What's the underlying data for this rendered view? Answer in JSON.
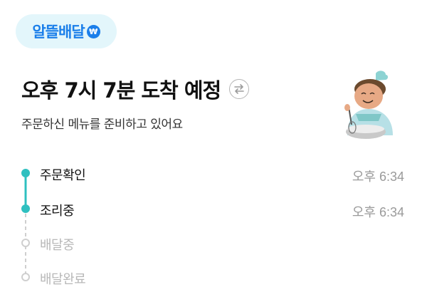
{
  "brand": {
    "badge_label": "알뜰배달",
    "badge_icon": "won-icon"
  },
  "header": {
    "eta_title": "오후 7시 7분 도착 예정",
    "status_message": "주문하신 메뉴를 준비하고 있어요",
    "swap_icon": "swap-arrows-icon"
  },
  "illustration": {
    "icon": "chef-illustration"
  },
  "steps": [
    {
      "label": "주문확인",
      "time": "오후 6:34",
      "done": true
    },
    {
      "label": "조리중",
      "time": "오후 6:34",
      "done": true
    },
    {
      "label": "배달중",
      "time": "",
      "done": false
    },
    {
      "label": "배달완료",
      "time": "",
      "done": false
    }
  ],
  "colors": {
    "accent": "#2fc0c0",
    "brand_blue": "#1b7fea",
    "badge_bg": "#e3f6fb",
    "pending": "#cfcfcf"
  }
}
